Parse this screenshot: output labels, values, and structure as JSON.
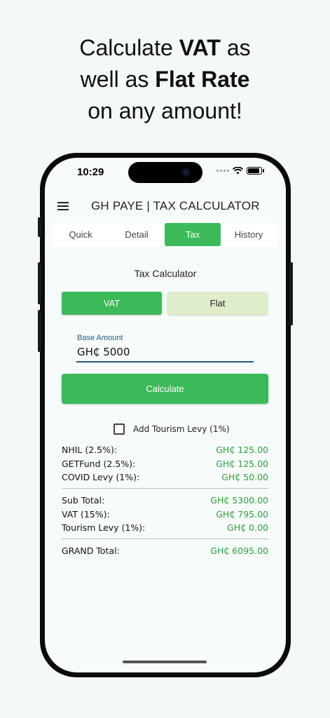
{
  "headline": {
    "line1_pre": "Calculate ",
    "line1_bold": "VAT",
    "line1_post": " as",
    "line2_pre": "well as ",
    "line2_bold": "Flat Rate",
    "line3": "on any amount!"
  },
  "status": {
    "time": "10:29"
  },
  "app": {
    "title": "GH PAYE | TAX CALCULATOR",
    "menu_icon": "hamburger-menu-icon",
    "tabs": [
      {
        "label": "Quick"
      },
      {
        "label": "Detail"
      },
      {
        "label": "Tax",
        "active": true
      },
      {
        "label": "History"
      }
    ],
    "section_title": "Tax Calculator",
    "mode_buttons": {
      "vat": "VAT",
      "flat": "Flat",
      "selected": "VAT"
    },
    "base_amount": {
      "label": "Base Amount",
      "value": "GH₵ 5000"
    },
    "calculate_label": "Calculate",
    "tourism_levy": {
      "label": "Add Tourism Levy (1%)",
      "checked": false
    },
    "levies": [
      {
        "label": "NHIL (2.5%):",
        "value": "GH₵ 125.00"
      },
      {
        "label": "GETFund (2.5%):",
        "value": "GH₵ 125.00"
      },
      {
        "label": "COVID Levy (1%):",
        "value": "GH₵ 50.00"
      }
    ],
    "totals": [
      {
        "label": "Sub Total:",
        "value": "GH₵ 5300.00"
      },
      {
        "label": "VAT (15%):",
        "value": "GH₵ 795.00"
      },
      {
        "label": "Tourism Levy (1%):",
        "value": "GH₵ 0.00"
      }
    ],
    "grand_total": {
      "label": "GRAND Total:",
      "value": "GH₵ 6095.00"
    }
  },
  "colors": {
    "accent_green": "#3cba5a",
    "flat_button_bg": "#dfedca",
    "value_green": "#2e9e3c",
    "input_underline": "#1f5e78",
    "background": "#f3f9f7"
  }
}
